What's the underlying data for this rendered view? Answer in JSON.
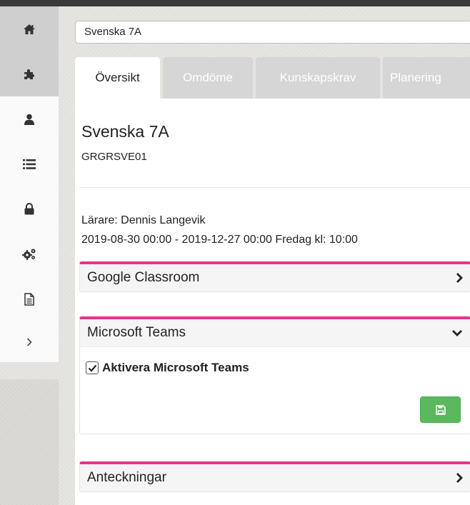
{
  "sidebar": {
    "items": [
      {
        "icon": "home-icon"
      },
      {
        "icon": "puzzle-icon"
      },
      {
        "icon": "user-icon"
      },
      {
        "icon": "list-icon"
      },
      {
        "icon": "lock-icon"
      },
      {
        "icon": "gears-icon"
      },
      {
        "icon": "document-icon"
      },
      {
        "icon": "chevron-right-icon"
      }
    ]
  },
  "course_select": {
    "value": "Svenska 7A"
  },
  "tabs": [
    {
      "label": "Översikt",
      "active": true
    },
    {
      "label": "Omdöme",
      "active": false
    },
    {
      "label": "Kunskapskrav",
      "active": false
    },
    {
      "label": "Planering",
      "active": false
    }
  ],
  "course": {
    "title": "Svenska 7A",
    "code": "GRGRSVE01",
    "teacher": "Lärare: Dennis Langevik",
    "dates": "2019-08-30 00:00 - 2019-12-27 00:00 Fredag kl: 10:00"
  },
  "panels": {
    "google": {
      "title": "Google Classroom",
      "expanded": false
    },
    "teams": {
      "title": "Microsoft Teams",
      "expanded": true,
      "checkbox_label": "Aktivera Microsoft Teams",
      "checked": true
    },
    "notes": {
      "title": "Anteckningar",
      "expanded": false
    }
  },
  "colors": {
    "accent": "#e8338b",
    "save": "#5cb85c",
    "tab_inactive": "#d6d6d6"
  }
}
